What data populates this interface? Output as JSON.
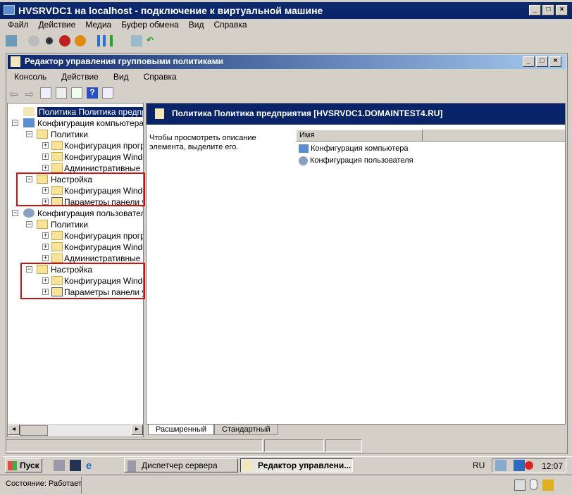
{
  "vm": {
    "title": "HVSRVDC1 на localhost - подключение к виртуальной машине",
    "menu": [
      "Файл",
      "Действие",
      "Медиа",
      "Буфер обмена",
      "Вид",
      "Справка"
    ],
    "status": "Состояние: Работает"
  },
  "gpme": {
    "title": "Редактор управления групповыми политиками",
    "menu": [
      "Консоль",
      "Действие",
      "Вид",
      "Справка"
    ],
    "tree": [
      {
        "label": "Политика  Политика предприяти",
        "level": 0,
        "icon": "scroll-icon"
      },
      {
        "label": "Конфигурация компьютера",
        "level": 0,
        "icon": "computer-icon",
        "exp": "−"
      },
      {
        "label": "Политики",
        "level": 1,
        "exp": "−"
      },
      {
        "label": "Конфигурация програ",
        "level": 2,
        "exp": "+"
      },
      {
        "label": "Конфигурация Window",
        "level": 2,
        "exp": "+"
      },
      {
        "label": "Административные ш",
        "level": 2,
        "exp": "+"
      },
      {
        "label": "Настройка",
        "level": 1,
        "exp": "−"
      },
      {
        "label": "Конфигурация Window",
        "level": 2,
        "exp": "+"
      },
      {
        "label": "Параметры панели уп",
        "level": 2,
        "exp": "+",
        "icon": "control-panel-icon"
      },
      {
        "label": "Конфигурация пользователя",
        "level": 0,
        "icon": "user-icon",
        "exp": "−"
      },
      {
        "label": "Политики",
        "level": 1,
        "exp": "−"
      },
      {
        "label": "Конфигурация програ",
        "level": 2,
        "exp": "+"
      },
      {
        "label": "Конфигурация Window",
        "level": 2,
        "exp": "+"
      },
      {
        "label": "Административные ш",
        "level": 2,
        "exp": "+"
      },
      {
        "label": "Настройка",
        "level": 1,
        "exp": "−"
      },
      {
        "label": "Конфигурация Window",
        "level": 2,
        "exp": "+"
      },
      {
        "label": "Параметры панели уп",
        "level": 2,
        "exp": "+",
        "icon": "control-panel-icon"
      }
    ],
    "header": "Политика  Политика предприятия [HVSRVDC1.DOMAINTEST4.RU]",
    "description": "Чтобы просмотреть описание элемента, выделите его.",
    "column": "Имя",
    "items": [
      "Конфигурация компьютера",
      "Конфигурация пользователя"
    ],
    "tabs": [
      "Расширенный",
      "Стандартный"
    ]
  },
  "taskbar": {
    "start": "Пуск",
    "buttons": [
      "Диспетчер сервера",
      "Редактор управлени..."
    ],
    "lang": "RU",
    "clock": "12:07"
  },
  "colors": {
    "titlebar": "#0a246a",
    "highlight": "#d01010"
  }
}
